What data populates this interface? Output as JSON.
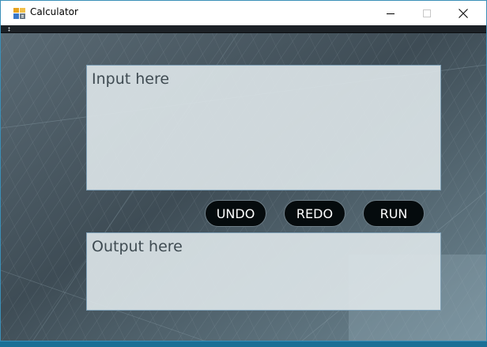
{
  "window": {
    "title": "Calculator",
    "app_icon": "calculator-app-icon",
    "controls": {
      "minimize_icon": "minimize-icon",
      "maximize_icon": "maximize-icon",
      "close_icon": "close-icon"
    }
  },
  "editor": {
    "input_placeholder": "Input here",
    "input_value": "",
    "output_placeholder": "Output here",
    "output_value": ""
  },
  "actions": {
    "undo_label": "UNDO",
    "redo_label": "REDO",
    "run_label": "RUN"
  },
  "colors": {
    "button_bg": "#050b0d",
    "textarea_bg": "#dbe4e7",
    "textarea_border": "#7d9fb6",
    "text": "#3f4b52"
  }
}
